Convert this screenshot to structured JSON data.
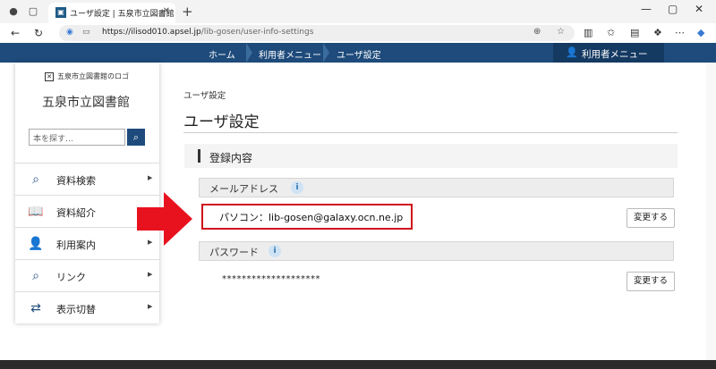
{
  "browser": {
    "tab_title": "ユーザ設定 | 五泉市立図書館",
    "url_host": "https://ilisod010.apsel.jp",
    "url_path": "/lib-gosen/user-info-settings"
  },
  "nav": {
    "breadcrumbs": [
      "ホーム",
      "利用者メニュー",
      "ユーザ設定"
    ],
    "user_menu_label": "利用者メニュー"
  },
  "sidebar": {
    "logo_alt": "五泉市立図書館のロゴ",
    "library_name": "五泉市立図書館",
    "search_placeholder": "本を探す…",
    "items": [
      {
        "label": "資料検索",
        "icon": "book-search-icon"
      },
      {
        "label": "資料紹介",
        "icon": "open-book-icon"
      },
      {
        "label": "利用案内",
        "icon": "person-icon"
      },
      {
        "label": "リンク",
        "icon": "link-icon"
      },
      {
        "label": "表示切替",
        "icon": "switch-arrows-icon"
      }
    ]
  },
  "main": {
    "breadcrumb": "ユーザ設定",
    "title": "ユーザ設定",
    "section_title": "登録内容",
    "email": {
      "label": "メールアドレス",
      "value": "パソコン：lib-gosen@galaxy.ocn.ne.jp",
      "button": "変更する"
    },
    "password": {
      "label": "パスワード",
      "value": "********************",
      "button": "変更する"
    }
  },
  "colors": {
    "brand": "#1e4b7b",
    "highlight": "#d0101b"
  }
}
